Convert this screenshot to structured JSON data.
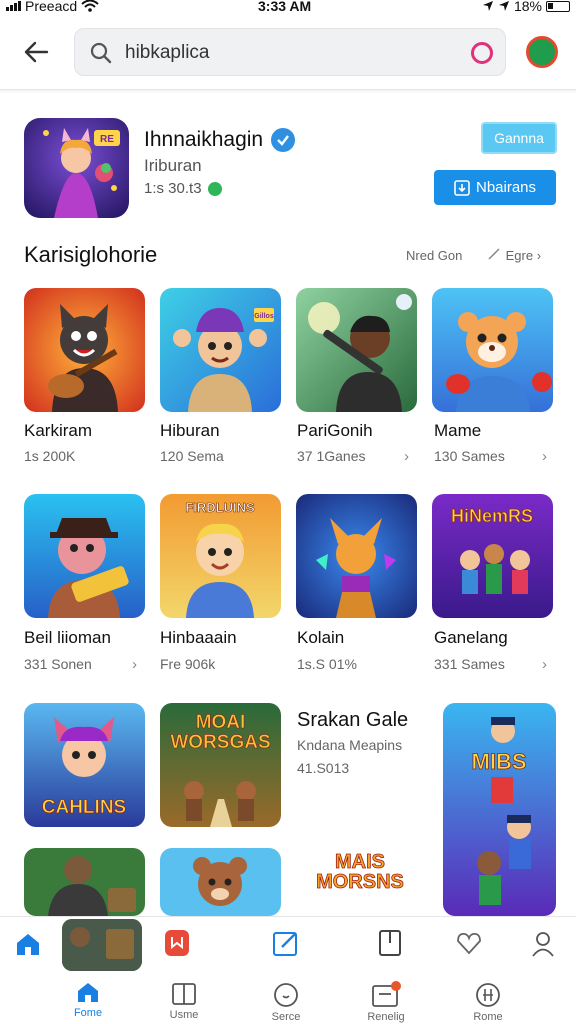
{
  "status_bar": {
    "carrier": "Preeacd",
    "time": "3:33 AM",
    "battery": "18%"
  },
  "search": {
    "query": "hibkaplica"
  },
  "app": {
    "name": "Ihnnaikhagin",
    "category": "Iriburan",
    "meta": "1:s 30.t3",
    "button_primary": "Gannna",
    "button_secondary": "Nbairans",
    "icon_text": "RE"
  },
  "section": {
    "title": "Karisiglohorie",
    "more_left": "Nred Gon",
    "more_right": "Egre"
  },
  "tiles": [
    {
      "name": "Karkiram",
      "sub": "1s 200K",
      "chevron": false
    },
    {
      "name": "Hiburan",
      "sub": "120 Sema",
      "chevron": false
    },
    {
      "name": "PariGonih",
      "sub": "37 1Ganes",
      "chevron": true
    },
    {
      "name": "Mame",
      "sub": "130 Sames",
      "chevron": true
    },
    {
      "name": "Beil liioman",
      "sub": "331 Sonen",
      "chevron": true
    },
    {
      "name": "Hinbaaain",
      "sub": "Fre 906k",
      "chevron": false
    },
    {
      "name": "Kolain",
      "sub": "1s.S 01%",
      "chevron": false
    },
    {
      "name": "Ganelang",
      "sub": "331 Sames",
      "chevron": true
    }
  ],
  "tile_art_text": [
    "Gillos",
    "FIRDLUINS",
    "HiNemRS",
    "CAHLINS",
    "MOAI WORSGAS",
    "MIBS",
    "MAIS MORSNS"
  ],
  "featured": {
    "title": "Srakan Gale",
    "subtitle": "Kndana Meapins",
    "meta": "41.S013"
  },
  "tabbar_top": [
    "home-icon",
    "bookmark-icon",
    "edit-icon",
    "book-icon",
    "heart-icon",
    "profile-icon"
  ],
  "tabbar_bottom": [
    {
      "label": "Fome",
      "icon": "home-icon",
      "active": true
    },
    {
      "label": "Usme",
      "icon": "library-icon",
      "active": false
    },
    {
      "label": "Serce",
      "icon": "search-icon",
      "active": false
    },
    {
      "label": "Renelig",
      "icon": "notification-icon",
      "active": false
    },
    {
      "label": "Rome",
      "icon": "settings-icon",
      "active": false
    }
  ],
  "colors": {
    "accent": "#1a8fe8",
    "accent_light": "#5ac8f2",
    "verified": "#2f8fe0",
    "active_tab": "#1a7fe3"
  }
}
